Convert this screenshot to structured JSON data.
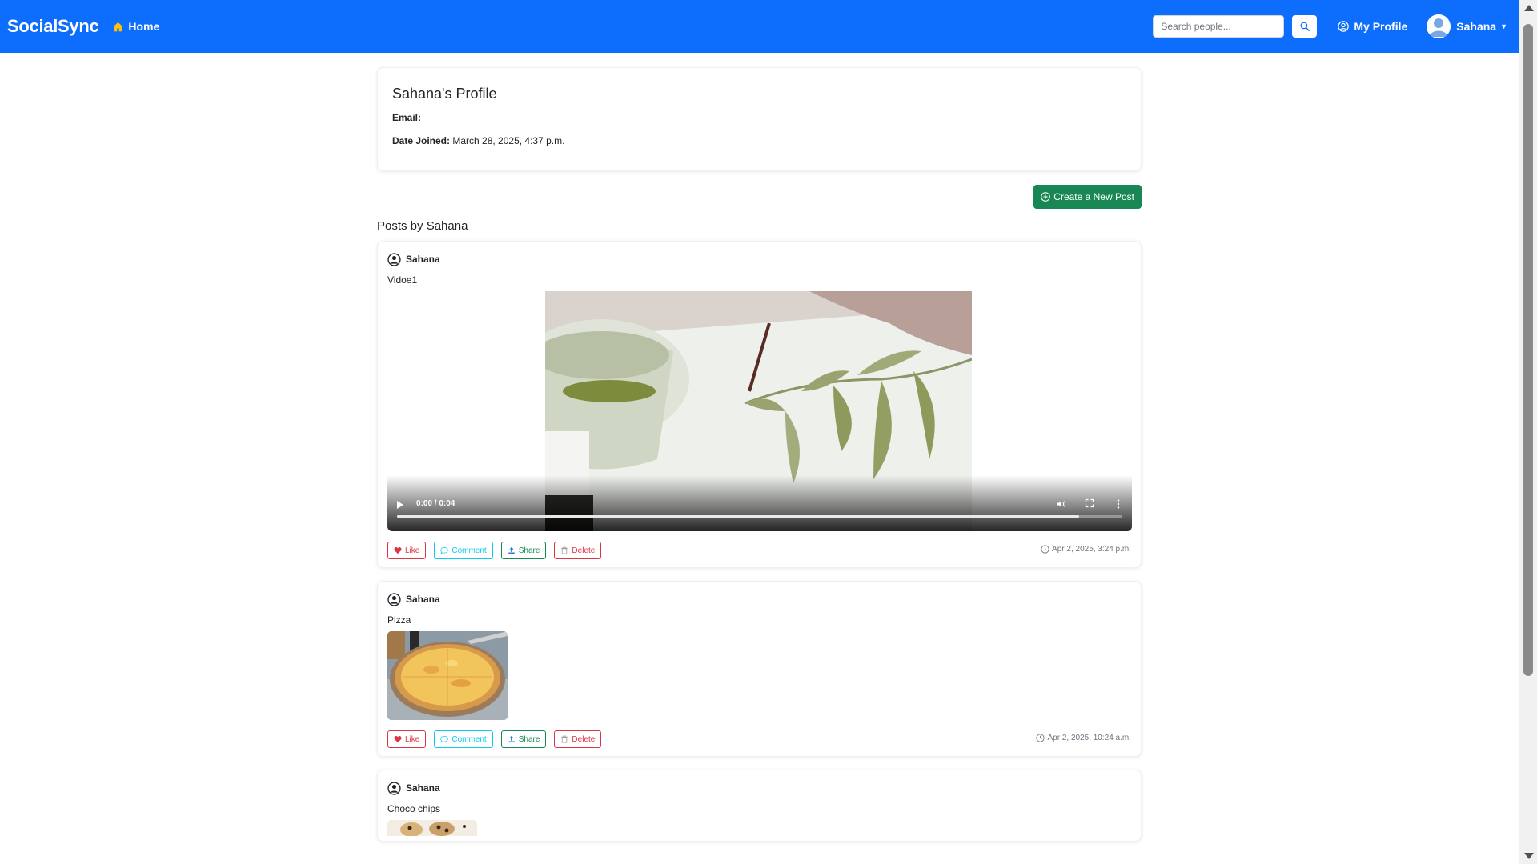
{
  "navbar": {
    "brand": "SocialSync",
    "home_label": "Home",
    "search_placeholder": "Search people...",
    "my_profile_label": "My Profile",
    "user_name": "Sahana"
  },
  "profile": {
    "title": "Sahana's Profile",
    "email_label": "Email:",
    "email_value": "",
    "date_joined_label": "Date Joined:",
    "date_joined_value": "March 28, 2025, 4:37 p.m."
  },
  "create_post_label": "Create a New Post",
  "posts_heading": "Posts by Sahana",
  "posts": [
    {
      "author": "Sahana",
      "text": "Vidoe1",
      "media": "video",
      "video_time": "0:00 / 0:04",
      "video_progress": 0.94,
      "timestamp": "Apr 2, 2025, 3:24 p.m."
    },
    {
      "author": "Sahana",
      "text": "Pizza",
      "media": "image",
      "timestamp": "Apr 2, 2025, 10:24 a.m."
    },
    {
      "author": "Sahana",
      "text": "Choco chips",
      "media": "image"
    }
  ],
  "actions": {
    "like": "Like",
    "comment": "Comment",
    "share": "Share",
    "delete": "Delete"
  },
  "colors": {
    "navbar": "#0d6efd",
    "success": "#198754",
    "danger": "#dc3545",
    "info": "#0dcaf0"
  }
}
